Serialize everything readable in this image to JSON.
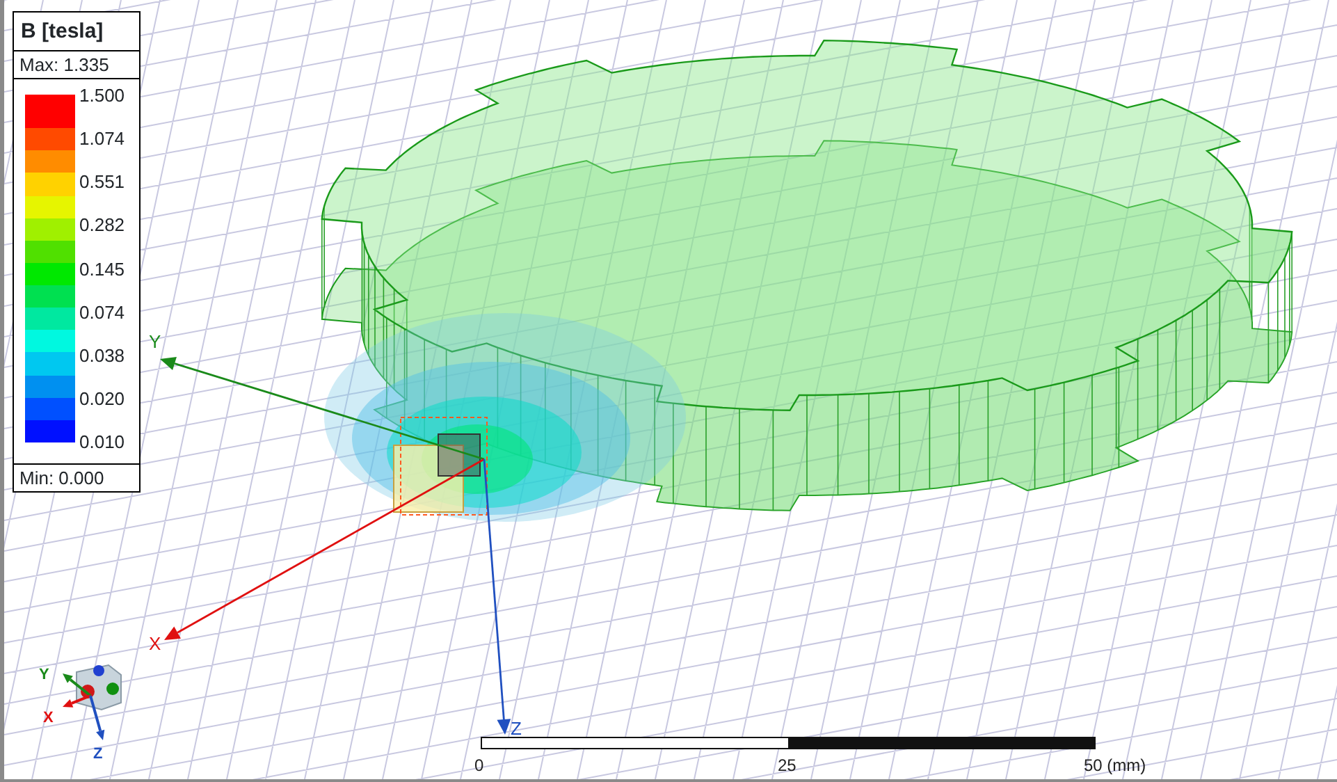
{
  "legend": {
    "title": "B [tesla]",
    "max": "Max: 1.335",
    "min": "Min: 0.000",
    "bands": [
      {
        "color": "#ff0000"
      },
      {
        "color": "#ff4a00"
      },
      {
        "color": "#ff8c00"
      },
      {
        "color": "#ffd200"
      },
      {
        "color": "#e6f500"
      },
      {
        "color": "#a0f000"
      },
      {
        "color": "#50e000"
      },
      {
        "color": "#00e800"
      },
      {
        "color": "#00e050"
      },
      {
        "color": "#00e8a0"
      },
      {
        "color": "#00f8e0"
      },
      {
        "color": "#00c8f0"
      },
      {
        "color": "#0090f0"
      },
      {
        "color": "#0050ff"
      },
      {
        "color": "#0010ff"
      }
    ],
    "labels": [
      "1.500",
      "1.074",
      "0.551",
      "0.282",
      "0.145",
      "0.074",
      "0.038",
      "0.020",
      "0.010"
    ]
  },
  "axes": [
    {
      "kind": "y",
      "label": "Y"
    },
    {
      "kind": "x",
      "label": "X"
    },
    {
      "kind": "z",
      "label": "Z"
    }
  ],
  "triad": [
    {
      "kind": "y",
      "label": "Y"
    },
    {
      "kind": "x",
      "label": "X"
    },
    {
      "kind": "z",
      "label": "Z"
    }
  ],
  "scale_bar": {
    "ticks": [
      "0",
      "25",
      "50 (mm)"
    ]
  }
}
